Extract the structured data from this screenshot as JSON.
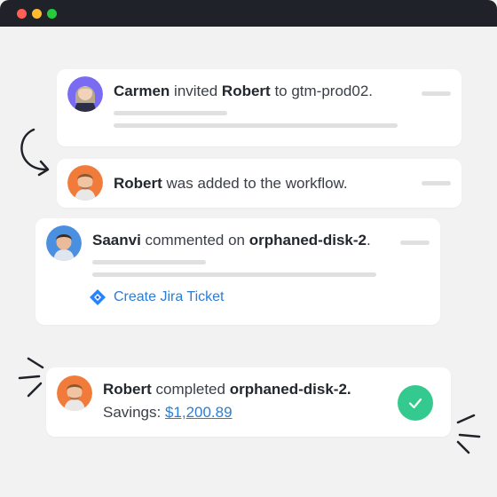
{
  "window": {
    "controls": [
      "close",
      "minimize",
      "maximize"
    ]
  },
  "colors": {
    "accent": "#2d7dd2",
    "success": "#34c98e",
    "titlebar": "#1f2228"
  },
  "feed": [
    {
      "actor": "Carmen",
      "verb": "invited",
      "object": "Robert",
      "prep": "to gtm-prod02."
    },
    {
      "actor": "Robert",
      "text": "was added to the workflow."
    },
    {
      "actor": "Saanvi",
      "verb": "commented on",
      "object": "orphaned-disk-2",
      "suffix": ".",
      "action_label": "Create Jira Ticket",
      "action_icon": "jira-icon"
    },
    {
      "actor": "Robert",
      "verb": "completed",
      "object": "orphaned-disk-2.",
      "savings_label": "Savings:",
      "savings_value": "$1,200.89",
      "status_icon": "checkmark-icon"
    }
  ]
}
